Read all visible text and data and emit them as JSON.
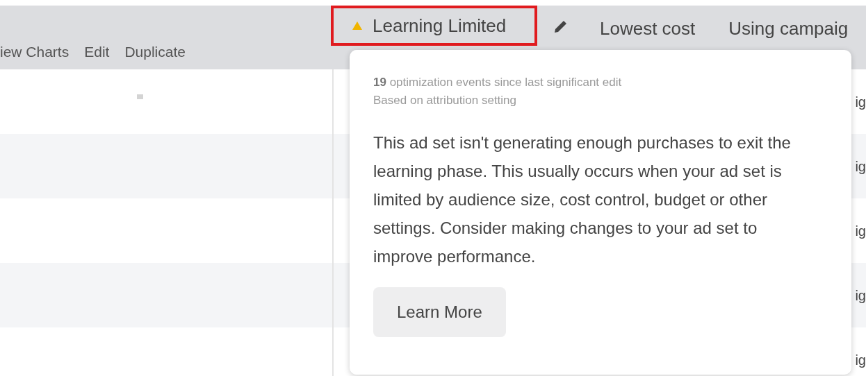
{
  "toolbar": {
    "actions": [
      {
        "label": "iew Charts"
      },
      {
        "label": "Edit"
      },
      {
        "label": "Duplicate"
      }
    ]
  },
  "delivery": {
    "label": "Learning Limited",
    "kind": "warning",
    "highlighted": true
  },
  "bid_strategy": {
    "label": "Lowest cost"
  },
  "column_last": {
    "label": "Using campaig"
  },
  "rows": [
    {
      "column_last": "ig",
      "marker": true
    },
    {
      "column_last": "ig",
      "marker": false
    },
    {
      "column_last": "ig",
      "marker": false
    },
    {
      "column_last": "ig",
      "marker": false
    },
    {
      "column_last": "ig",
      "marker": false
    }
  ],
  "tooltip": {
    "summary": "**19** optimization events since last significant edit",
    "subtext": "Based on attribution setting",
    "body": "This ad set isn't generating enough purchases to exit the learning phase. This usually occurs when your ad set is limited by audience size, cost control, budget or other settings. Consider making changes to your ad set to improve performance.",
    "button": "Learn More"
  }
}
